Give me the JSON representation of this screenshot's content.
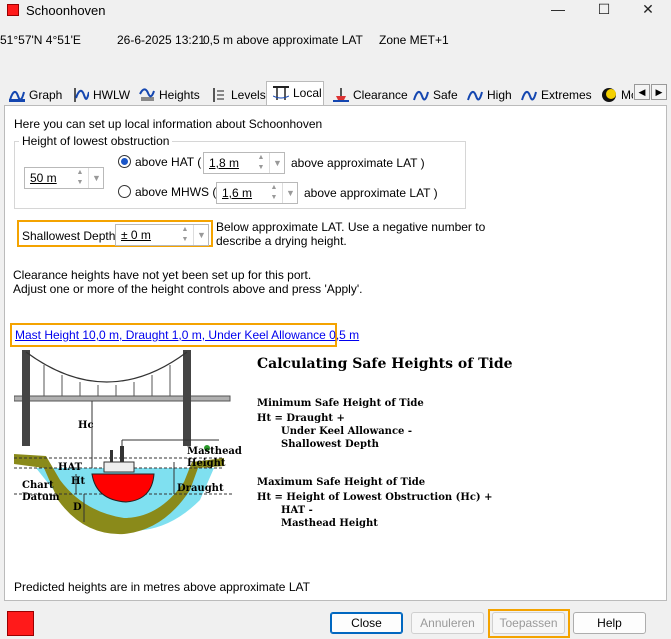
{
  "window": {
    "title": "Schoonhoven",
    "minimize": "—",
    "maximize": "☐",
    "close": "✕"
  },
  "info": {
    "position": "51°57'N 4°51'E",
    "datetime": "26-6-2025 13:21",
    "height": "0,5 m above approximate LAT",
    "zone": "Zone  MET+1"
  },
  "tabs": [
    {
      "label": "Graph",
      "icon": "graph-icon"
    },
    {
      "label": "HWLW",
      "icon": "hwlw-icon"
    },
    {
      "label": "Heights",
      "icon": "heights-icon"
    },
    {
      "label": "Levels",
      "icon": "levels-icon"
    },
    {
      "label": "Local",
      "icon": "bridge-icon"
    },
    {
      "label": "Clearance",
      "icon": "clearance-icon"
    },
    {
      "label": "Safe",
      "icon": "safe-icon"
    },
    {
      "label": "High",
      "icon": "high-icon"
    },
    {
      "label": "Extremes",
      "icon": "extremes-icon"
    },
    {
      "label": "Mo",
      "icon": "moon-icon"
    }
  ],
  "active_tab": "Local",
  "local": {
    "intro": "Here you can set up local information about Schoonhoven",
    "group_title": "Height of lowest obstruction",
    "obstruction_value": "50 m",
    "above_hat_label": "above HAT (",
    "hat_value": "1,8 m",
    "hat_suffix": "above approximate LAT )",
    "above_mhws_label": "above MHWS (",
    "mhws_value": "1,6 m",
    "mhws_suffix": "above approximate LAT )",
    "selected_reference": "HAT",
    "shallowest_label": "Shallowest Depth",
    "shallowest_value": "± 0 m",
    "shallowest_note_1": "Below approximate LAT. Use a negative number to",
    "shallowest_note_2": "describe a drying height.",
    "clearance_msg_1": "Clearance heights have not yet been set up for this port.",
    "clearance_msg_2": "Adjust one or more of the height controls above and press 'Apply'.",
    "vessel_link": "Mast Height 10,0 m, Draught 1,0 m, Under Keel Allowance 0,5 m",
    "footer": "Predicted heights are in metres above approximate LAT"
  },
  "diagram": {
    "heading": "Calculating Safe Heights of Tide",
    "min_title": "Minimum Safe Height of Tide",
    "min_line1": "Ht = Draught +",
    "min_line2": "Under Keel Allowance -",
    "min_line3": "Shallowest Depth",
    "max_title": "Maximum Safe Height of Tide",
    "max_line1": "Ht = Height of Lowest Obstruction (Hc) +",
    "max_line2": "HAT -",
    "max_line3": "Masthead Height",
    "labels": {
      "hc": "Hc",
      "hat": "HAT",
      "ht": "Ht",
      "d": "D",
      "chart_datum_1": "Chart",
      "chart_datum_2": "Datum",
      "masthead_1": "Masthead",
      "masthead_2": "Height",
      "draught": "Draught"
    }
  },
  "buttons": {
    "close": "Close",
    "cancel": "Annuleren",
    "apply": "Toepassen",
    "help": "Help"
  },
  "colors": {
    "accent": "#0067c0",
    "highlight": "#f4a300",
    "water": "#7fe0f0",
    "hull": "#ff0000",
    "bank": "#8a8a1a",
    "tide_red": "#ff1a1a"
  }
}
